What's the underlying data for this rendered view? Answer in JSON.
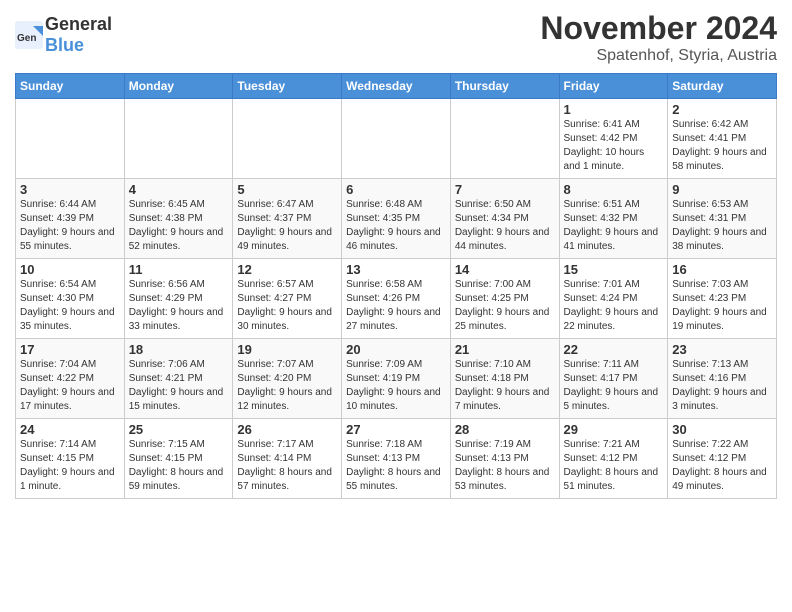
{
  "logo": {
    "general": "General",
    "blue": "Blue"
  },
  "title": "November 2024",
  "location": "Spatenhof, Styria, Austria",
  "headers": [
    "Sunday",
    "Monday",
    "Tuesday",
    "Wednesday",
    "Thursday",
    "Friday",
    "Saturday"
  ],
  "weeks": [
    [
      {
        "day": "",
        "info": ""
      },
      {
        "day": "",
        "info": ""
      },
      {
        "day": "",
        "info": ""
      },
      {
        "day": "",
        "info": ""
      },
      {
        "day": "",
        "info": ""
      },
      {
        "day": "1",
        "info": "Sunrise: 6:41 AM\nSunset: 4:42 PM\nDaylight: 10 hours and 1 minute."
      },
      {
        "day": "2",
        "info": "Sunrise: 6:42 AM\nSunset: 4:41 PM\nDaylight: 9 hours and 58 minutes."
      }
    ],
    [
      {
        "day": "3",
        "info": "Sunrise: 6:44 AM\nSunset: 4:39 PM\nDaylight: 9 hours and 55 minutes."
      },
      {
        "day": "4",
        "info": "Sunrise: 6:45 AM\nSunset: 4:38 PM\nDaylight: 9 hours and 52 minutes."
      },
      {
        "day": "5",
        "info": "Sunrise: 6:47 AM\nSunset: 4:37 PM\nDaylight: 9 hours and 49 minutes."
      },
      {
        "day": "6",
        "info": "Sunrise: 6:48 AM\nSunset: 4:35 PM\nDaylight: 9 hours and 46 minutes."
      },
      {
        "day": "7",
        "info": "Sunrise: 6:50 AM\nSunset: 4:34 PM\nDaylight: 9 hours and 44 minutes."
      },
      {
        "day": "8",
        "info": "Sunrise: 6:51 AM\nSunset: 4:32 PM\nDaylight: 9 hours and 41 minutes."
      },
      {
        "day": "9",
        "info": "Sunrise: 6:53 AM\nSunset: 4:31 PM\nDaylight: 9 hours and 38 minutes."
      }
    ],
    [
      {
        "day": "10",
        "info": "Sunrise: 6:54 AM\nSunset: 4:30 PM\nDaylight: 9 hours and 35 minutes."
      },
      {
        "day": "11",
        "info": "Sunrise: 6:56 AM\nSunset: 4:29 PM\nDaylight: 9 hours and 33 minutes."
      },
      {
        "day": "12",
        "info": "Sunrise: 6:57 AM\nSunset: 4:27 PM\nDaylight: 9 hours and 30 minutes."
      },
      {
        "day": "13",
        "info": "Sunrise: 6:58 AM\nSunset: 4:26 PM\nDaylight: 9 hours and 27 minutes."
      },
      {
        "day": "14",
        "info": "Sunrise: 7:00 AM\nSunset: 4:25 PM\nDaylight: 9 hours and 25 minutes."
      },
      {
        "day": "15",
        "info": "Sunrise: 7:01 AM\nSunset: 4:24 PM\nDaylight: 9 hours and 22 minutes."
      },
      {
        "day": "16",
        "info": "Sunrise: 7:03 AM\nSunset: 4:23 PM\nDaylight: 9 hours and 19 minutes."
      }
    ],
    [
      {
        "day": "17",
        "info": "Sunrise: 7:04 AM\nSunset: 4:22 PM\nDaylight: 9 hours and 17 minutes."
      },
      {
        "day": "18",
        "info": "Sunrise: 7:06 AM\nSunset: 4:21 PM\nDaylight: 9 hours and 15 minutes."
      },
      {
        "day": "19",
        "info": "Sunrise: 7:07 AM\nSunset: 4:20 PM\nDaylight: 9 hours and 12 minutes."
      },
      {
        "day": "20",
        "info": "Sunrise: 7:09 AM\nSunset: 4:19 PM\nDaylight: 9 hours and 10 minutes."
      },
      {
        "day": "21",
        "info": "Sunrise: 7:10 AM\nSunset: 4:18 PM\nDaylight: 9 hours and 7 minutes."
      },
      {
        "day": "22",
        "info": "Sunrise: 7:11 AM\nSunset: 4:17 PM\nDaylight: 9 hours and 5 minutes."
      },
      {
        "day": "23",
        "info": "Sunrise: 7:13 AM\nSunset: 4:16 PM\nDaylight: 9 hours and 3 minutes."
      }
    ],
    [
      {
        "day": "24",
        "info": "Sunrise: 7:14 AM\nSunset: 4:15 PM\nDaylight: 9 hours and 1 minute."
      },
      {
        "day": "25",
        "info": "Sunrise: 7:15 AM\nSunset: 4:15 PM\nDaylight: 8 hours and 59 minutes."
      },
      {
        "day": "26",
        "info": "Sunrise: 7:17 AM\nSunset: 4:14 PM\nDaylight: 8 hours and 57 minutes."
      },
      {
        "day": "27",
        "info": "Sunrise: 7:18 AM\nSunset: 4:13 PM\nDaylight: 8 hours and 55 minutes."
      },
      {
        "day": "28",
        "info": "Sunrise: 7:19 AM\nSunset: 4:13 PM\nDaylight: 8 hours and 53 minutes."
      },
      {
        "day": "29",
        "info": "Sunrise: 7:21 AM\nSunset: 4:12 PM\nDaylight: 8 hours and 51 minutes."
      },
      {
        "day": "30",
        "info": "Sunrise: 7:22 AM\nSunset: 4:12 PM\nDaylight: 8 hours and 49 minutes."
      }
    ]
  ]
}
